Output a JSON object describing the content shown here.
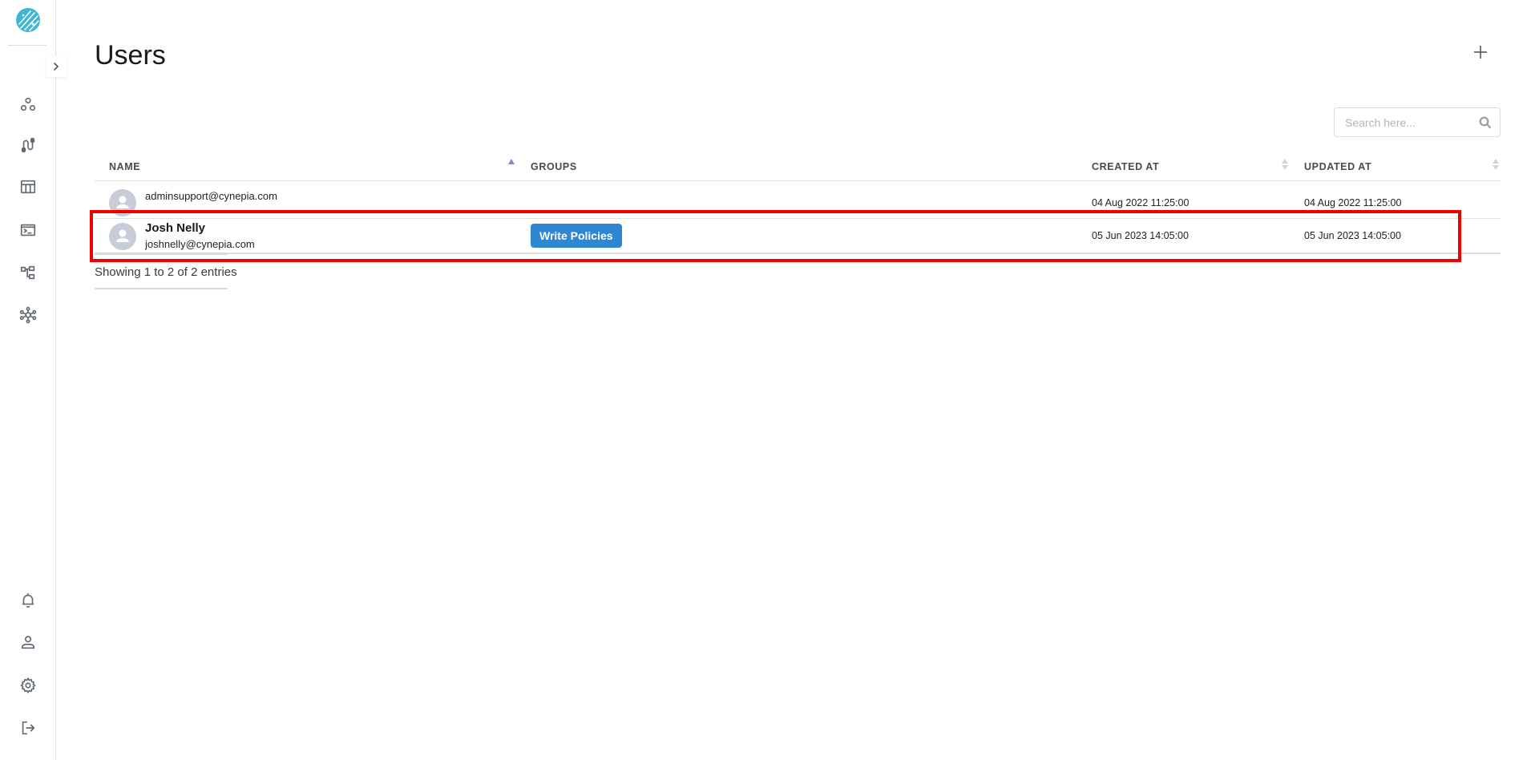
{
  "sidebar": {
    "logo": "cynepia-logo",
    "expand_icon": "chevron-right-icon",
    "top_items": [
      {
        "name": "nodes-icon"
      },
      {
        "name": "pipeline-icon"
      },
      {
        "name": "table-icon"
      },
      {
        "name": "terminal-icon"
      },
      {
        "name": "hierarchy-icon"
      },
      {
        "name": "network-icon"
      }
    ],
    "bottom_items": [
      {
        "name": "bell-icon"
      },
      {
        "name": "user-icon"
      },
      {
        "name": "gear-icon"
      },
      {
        "name": "logout-icon"
      }
    ]
  },
  "header": {
    "title": "Users",
    "add_icon": "plus-icon"
  },
  "search": {
    "placeholder": "Search here...",
    "value": ""
  },
  "table": {
    "columns": [
      {
        "label": "NAME",
        "sort": "ascending"
      },
      {
        "label": "GROUPS",
        "sort": "none"
      },
      {
        "label": "CREATED AT",
        "sort": "sortable"
      },
      {
        "label": "UPDATED AT",
        "sort": "sortable"
      }
    ],
    "rows": [
      {
        "name": "",
        "email": "adminsupport@cynepia.com",
        "groups": [],
        "created_at": "04 Aug 2022 11:25:00",
        "updated_at": "04 Aug 2022 11:25:00"
      },
      {
        "name": "Josh Nelly",
        "email": "joshnelly@cynepia.com",
        "groups": [
          "Write Policies"
        ],
        "created_at": "05 Jun 2023 14:05:00",
        "updated_at": "05 Jun 2023 14:05:00"
      }
    ]
  },
  "footer": {
    "entries_info": "Showing 1 to 2 of 2 entries"
  },
  "highlight": {
    "color": "#ee0000",
    "target": "row-josh-nelly"
  },
  "colors": {
    "accent_blue": "#2f86d3",
    "sort_active": "#8b84d7",
    "logo": "#3fb6d3"
  }
}
